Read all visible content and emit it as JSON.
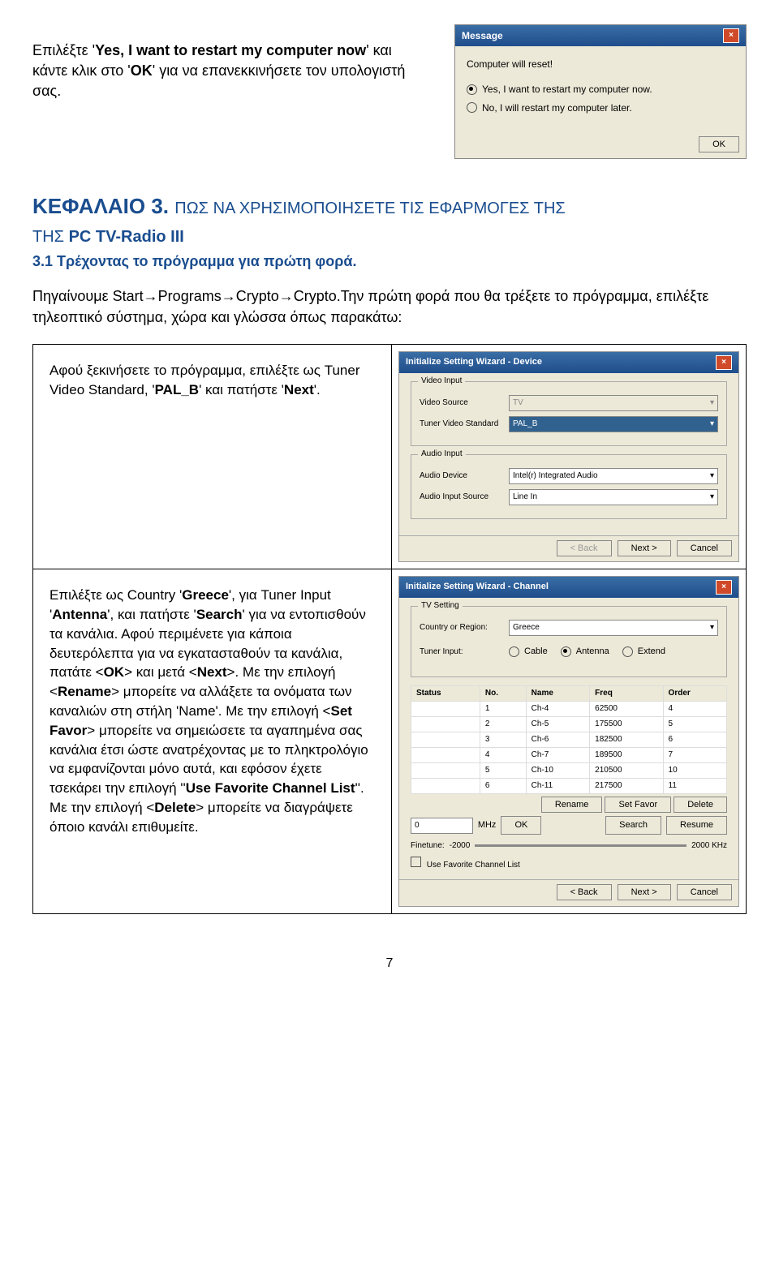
{
  "intro": {
    "text1": "Επιλέξτε '",
    "bold1": "Yes, I want to restart my computer now",
    "text2": "' και κάντε κλικ στο '",
    "bold2": "OK",
    "text3": "' για να επανεκκινήσετε τον υπολογιστή σας."
  },
  "message_dialog": {
    "title": "Message",
    "body": "Computer will reset!",
    "opt1": "Yes, I want to restart my computer now.",
    "opt2": "No, I will restart my computer later.",
    "ok": "OK"
  },
  "chapter": {
    "title": "ΚΕΦΑΛΑΙΟ 3.",
    "subtitle_pre": "ΠΩΣ ΝΑ ΧΡΗΣΙΜΟΠΟΙΗΣΕΤΕ ΤΙΣ ΕΦΑΡΜΟΓΕΣ ΤΗΣ ",
    "subtitle_bold": "PC TV-Radio III",
    "section": "3.1 Τρέχοντας το πρόγραμμα για πρώτη φορά."
  },
  "para2": "Πηγαίνουμε Start→Programs→Crypto→Crypto.Την πρώτη φορά που θα τρέξετε το πρόγραμμα, επιλέξτε τηλεοπτικό σύστημα, χώρα και γλώσσα όπως παρακάτω:",
  "row1": {
    "p1": "Αφού ξεκινήσετε το πρόγραμμα, επιλέξτε ως Tuner Video Standard, '",
    "b1": "PAL_B",
    "p2": "' και πατήστε '",
    "b2": "Next",
    "p3": "'."
  },
  "wizard1": {
    "title": "Initialize Setting Wizard - Device",
    "grp1": "Video Input",
    "lbl_vs": "Video Source",
    "val_vs": "TV",
    "lbl_tvs": "Tuner Video Standard",
    "val_tvs": "PAL_B",
    "grp2": "Audio Input",
    "lbl_ad": "Audio Device",
    "val_ad": "Intel(r) Integrated Audio",
    "lbl_ais": "Audio Input Source",
    "val_ais": "Line In",
    "back": "< Back",
    "next": "Next >",
    "cancel": "Cancel"
  },
  "row2": {
    "text": "Επιλέξτε ως Country 'Greece', για Tuner Input 'Antenna', και πατήστε 'Search' για να εντοπισθούν τα κανάλια. Αφού περιμένετε για κάποια δευτερόλεπτα για να εγκατασταθούν τα κανάλια, πατάτε <OK> και μετά <Next>. Με την επιλογή <Rename> μπορείτε να αλλάξετε τα ονόματα των καναλιών στη στήλη 'Name'. Με την επιλογή <Set Favor> μπορείτε να σημειώσετε τα αγαπημένα σας κανάλια έτσι ώστε ανατρέχοντας με το πληκτρολόγιο να εμφανίζονται μόνο αυτά, και εφόσον έχετε τσεκάρει την επιλογή ''Use Favorite Channel List''. Με την επιλογή <Delete> μπορείτε να διαγράψετε όποιο κανάλι επιθυμείτε."
  },
  "wizard2": {
    "title": "Initialize Setting Wizard - Channel",
    "grp": "TV Setting",
    "lbl_cr": "Country or Region:",
    "val_cr": "Greece",
    "lbl_ti": "Tuner Input:",
    "opt_cable": "Cable",
    "opt_ant": "Antenna",
    "opt_ext": "Extend",
    "th_status": "Status",
    "th_no": "No.",
    "th_name": "Name",
    "th_freq": "Freq",
    "th_order": "Order",
    "rows": [
      {
        "no": "1",
        "name": "Ch-4",
        "freq": "62500",
        "order": "4"
      },
      {
        "no": "2",
        "name": "Ch-5",
        "freq": "175500",
        "order": "5"
      },
      {
        "no": "3",
        "name": "Ch-6",
        "freq": "182500",
        "order": "6"
      },
      {
        "no": "4",
        "name": "Ch-7",
        "freq": "189500",
        "order": "7"
      },
      {
        "no": "5",
        "name": "Ch-10",
        "freq": "210500",
        "order": "10"
      },
      {
        "no": "6",
        "name": "Ch-11",
        "freq": "217500",
        "order": "11"
      }
    ],
    "btn_rename": "Rename",
    "btn_setfavor": "Set Favor",
    "btn_delete": "Delete",
    "freq_val": "0",
    "mhz": "MHz",
    "ok": "OK",
    "btn_search": "Search",
    "btn_resume": "Resume",
    "finetune": "Finetune:",
    "ft_lo": "-2000",
    "ft_hi": "2000 KHz",
    "usefav": "Use Favorite Channel List",
    "back": "< Back",
    "next": "Next >",
    "cancel": "Cancel"
  },
  "page": "7"
}
